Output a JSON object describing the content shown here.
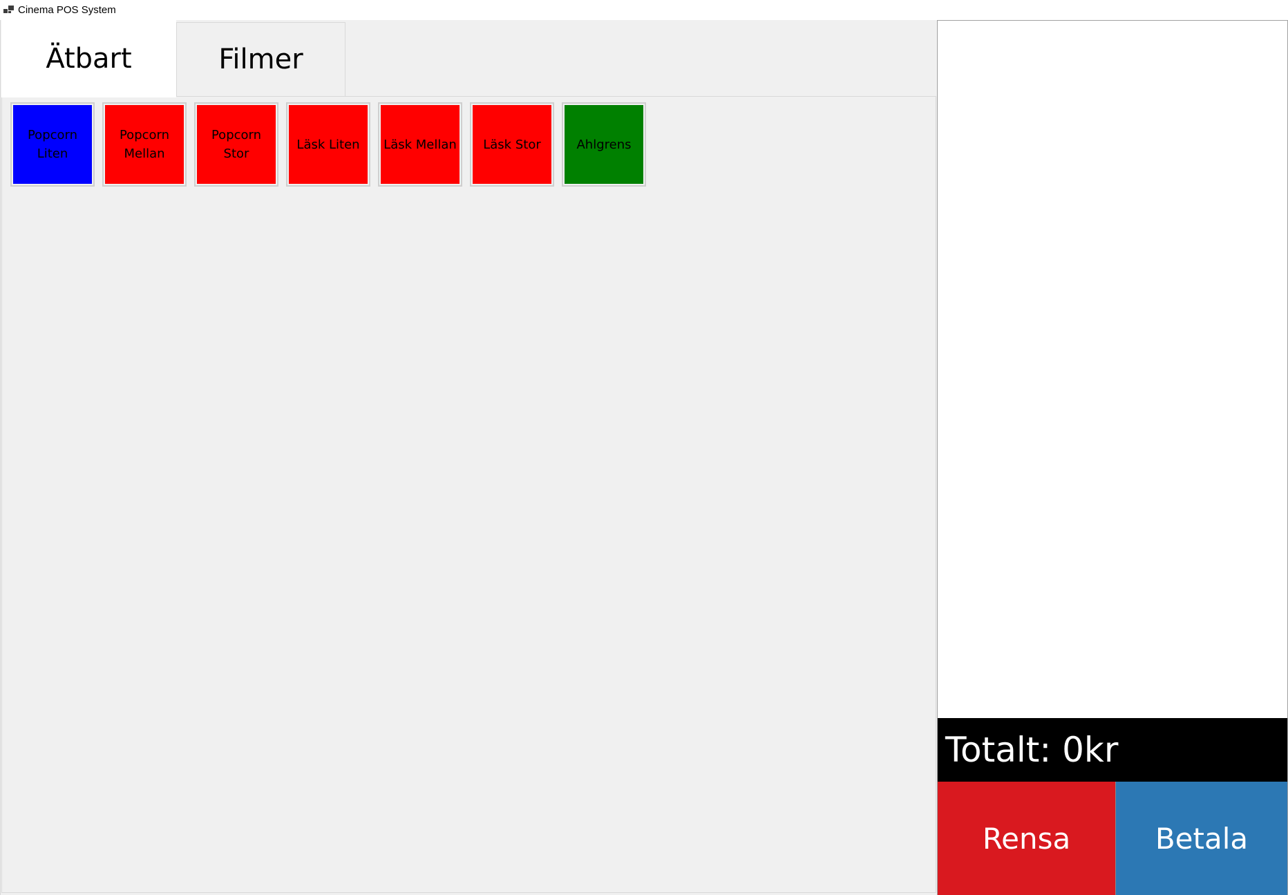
{
  "window": {
    "title": "Cinema POS System",
    "icon": "app-window-icon"
  },
  "tabs": [
    {
      "label": "Ätbart",
      "selected": true
    },
    {
      "label": "Filmer",
      "selected": false
    }
  ],
  "items": [
    {
      "label": "Popcorn Liten",
      "color": "#0000ff"
    },
    {
      "label": "Popcorn Mellan",
      "color": "#ff0000"
    },
    {
      "label": "Popcorn Stor",
      "color": "#ff0000"
    },
    {
      "label": "Läsk Liten",
      "color": "#ff0000"
    },
    {
      "label": "Läsk Mellan",
      "color": "#ff0000"
    },
    {
      "label": "Läsk Stor",
      "color": "#ff0000"
    },
    {
      "label": "Ahlgrens",
      "color": "#008000"
    }
  ],
  "cart": {
    "items": [],
    "total_label": "Totalt: 0kr"
  },
  "actions": {
    "clear_label": "Rensa",
    "clear_color": "#d9191f",
    "pay_label": "Betala",
    "pay_color": "#2c78b4"
  }
}
